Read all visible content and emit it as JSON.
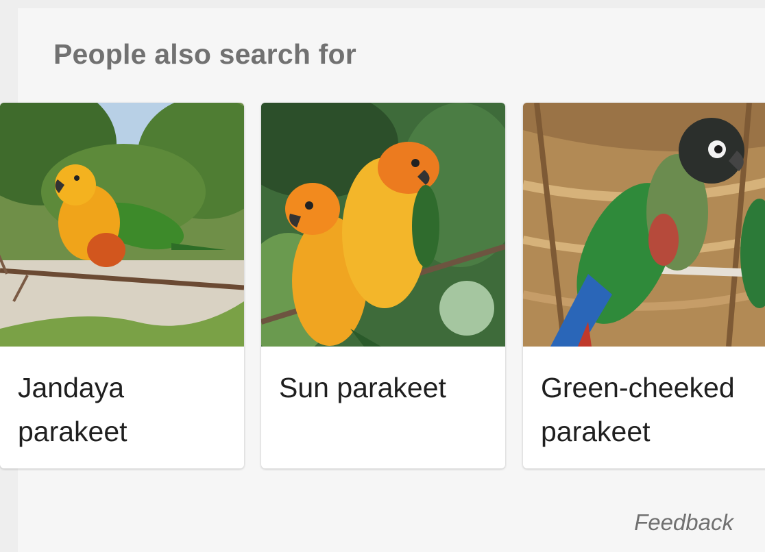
{
  "section": {
    "title": "People also search for"
  },
  "cards": [
    {
      "label": "Jandaya parakeet",
      "image": "jandaya-parakeet-photo"
    },
    {
      "label": "Sun parakeet",
      "image": "sun-parakeet-photo"
    },
    {
      "label": "Green-cheeked parakeet",
      "image": "green-cheeked-parakeet-photo"
    }
  ],
  "footer": {
    "feedback_label": "Feedback"
  },
  "colors": {
    "page_bg": "#eeeeee",
    "panel_bg": "#f6f6f6",
    "card_bg": "#ffffff",
    "heading_text": "#717171",
    "label_text": "#1f1f1f",
    "feedback_text": "#707070"
  }
}
